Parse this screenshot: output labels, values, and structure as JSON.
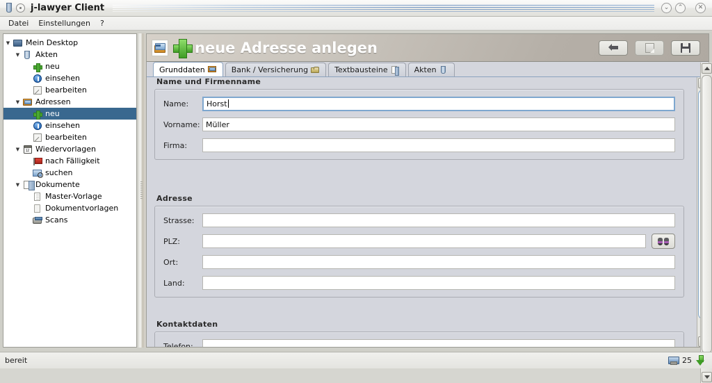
{
  "window": {
    "title": "j-lawyer Client",
    "doc_icon": "document-icon",
    "circle_icon": "app-circle-icon",
    "minimize_label": "⌄",
    "maximize_label": "⌃",
    "close_label": "✕"
  },
  "menubar": {
    "items": [
      {
        "label": "Datei",
        "name": "menu-datei"
      },
      {
        "label": "Einstellungen",
        "name": "menu-einstellungen"
      },
      {
        "label": "?",
        "name": "menu-help"
      }
    ]
  },
  "sidebar": {
    "items": [
      {
        "label": "Mein Desktop",
        "icon": "monitor-icon",
        "indent": 0,
        "twisty": "▼",
        "selected": false
      },
      {
        "label": "Akten",
        "icon": "folder-blue-icon",
        "indent": 1,
        "twisty": "▼",
        "selected": false
      },
      {
        "label": "neu",
        "icon": "plus-green-icon",
        "indent": 2,
        "twisty": "",
        "selected": false
      },
      {
        "label": "einsehen",
        "icon": "info-icon",
        "indent": 2,
        "twisty": "",
        "selected": false
      },
      {
        "label": "bearbeiten",
        "icon": "pencil-icon",
        "indent": 2,
        "twisty": "",
        "selected": false
      },
      {
        "label": "Adressen",
        "icon": "address-card-icon",
        "indent": 1,
        "twisty": "▼",
        "selected": false
      },
      {
        "label": "neu",
        "icon": "plus-green-icon",
        "indent": 2,
        "twisty": "",
        "selected": true
      },
      {
        "label": "einsehen",
        "icon": "info-icon",
        "indent": 2,
        "twisty": "",
        "selected": false
      },
      {
        "label": "bearbeiten",
        "icon": "pencil-icon",
        "indent": 2,
        "twisty": "",
        "selected": false
      },
      {
        "label": "Wiedervorlagen",
        "icon": "calendar-icon",
        "indent": 1,
        "twisty": "▼",
        "selected": false
      },
      {
        "label": "nach Fälligkeit",
        "icon": "flag-red-icon",
        "indent": 2,
        "twisty": "",
        "selected": false
      },
      {
        "label": "suchen",
        "icon": "image-search-icon",
        "indent": 2,
        "twisty": "",
        "selected": false
      },
      {
        "label": "Dokumente",
        "icon": "documents-icon",
        "indent": 1,
        "twisty": "▼",
        "selected": false
      },
      {
        "label": "Master-Vorlage",
        "icon": "page-lines-icon",
        "indent": 2,
        "twisty": "",
        "selected": false
      },
      {
        "label": "Dokumentvorlagen",
        "icon": "page-plain-icon",
        "indent": 2,
        "twisty": "",
        "selected": false
      },
      {
        "label": "Scans",
        "icon": "scanner-icon",
        "indent": 2,
        "twisty": "",
        "selected": false
      }
    ],
    "selection_color": "#39688f"
  },
  "main": {
    "header": {
      "title": "neue Adresse anlegen",
      "icon": "address-card-icon",
      "plus_icon": "plus-green-icon",
      "buttons": [
        {
          "name": "back-button",
          "icon": "arrow-left-icon"
        },
        {
          "name": "note-button",
          "icon": "note-icon"
        },
        {
          "name": "save-button",
          "icon": "save-floppy-icon"
        }
      ]
    },
    "tabs": [
      {
        "label": "Grunddaten",
        "icon": "address-card-icon",
        "active": true
      },
      {
        "label": "Bank / Versicherung",
        "icon": "bank-icon",
        "active": false
      },
      {
        "label": "Textbausteine",
        "icon": "document-icon",
        "active": false
      },
      {
        "label": "Akten",
        "icon": "folder-blue-icon",
        "active": false
      }
    ],
    "groups": [
      {
        "title": "Name und Firmenname",
        "name": "group-name-firmenname",
        "fields": [
          {
            "label": "Name:",
            "value": "Horst",
            "placeholder": "",
            "focused": true,
            "name": "name-field"
          },
          {
            "label": "Vorname:",
            "value": "Müller",
            "placeholder": "",
            "focused": false,
            "name": "vorname-field"
          },
          {
            "label": "Firma:",
            "value": "",
            "placeholder": "",
            "focused": false,
            "name": "firma-field"
          }
        ]
      },
      {
        "title": "Adresse",
        "name": "group-adresse",
        "fields": [
          {
            "label": "Strasse:",
            "value": "",
            "placeholder": "",
            "focused": false,
            "name": "strasse-field"
          },
          {
            "label": "PLZ:",
            "value": "",
            "placeholder": "",
            "focused": false,
            "name": "plz-field",
            "lookup": true,
            "lookup_icon": "binoculars-icon"
          },
          {
            "label": "Ort:",
            "value": "",
            "placeholder": "",
            "focused": false,
            "name": "ort-field"
          },
          {
            "label": "Land:",
            "value": "",
            "placeholder": "",
            "focused": false,
            "name": "land-field"
          }
        ]
      },
      {
        "title": "Kontaktdaten",
        "name": "group-kontaktdaten",
        "fields": [
          {
            "label": "Telefon:",
            "value": "",
            "placeholder": "",
            "focused": false,
            "name": "telefon-field"
          }
        ]
      }
    ]
  },
  "statusbar": {
    "message": "bereit",
    "count": "25",
    "monitor_icon": "server-monitor-icon",
    "download_icon": "download-arrow-icon"
  }
}
